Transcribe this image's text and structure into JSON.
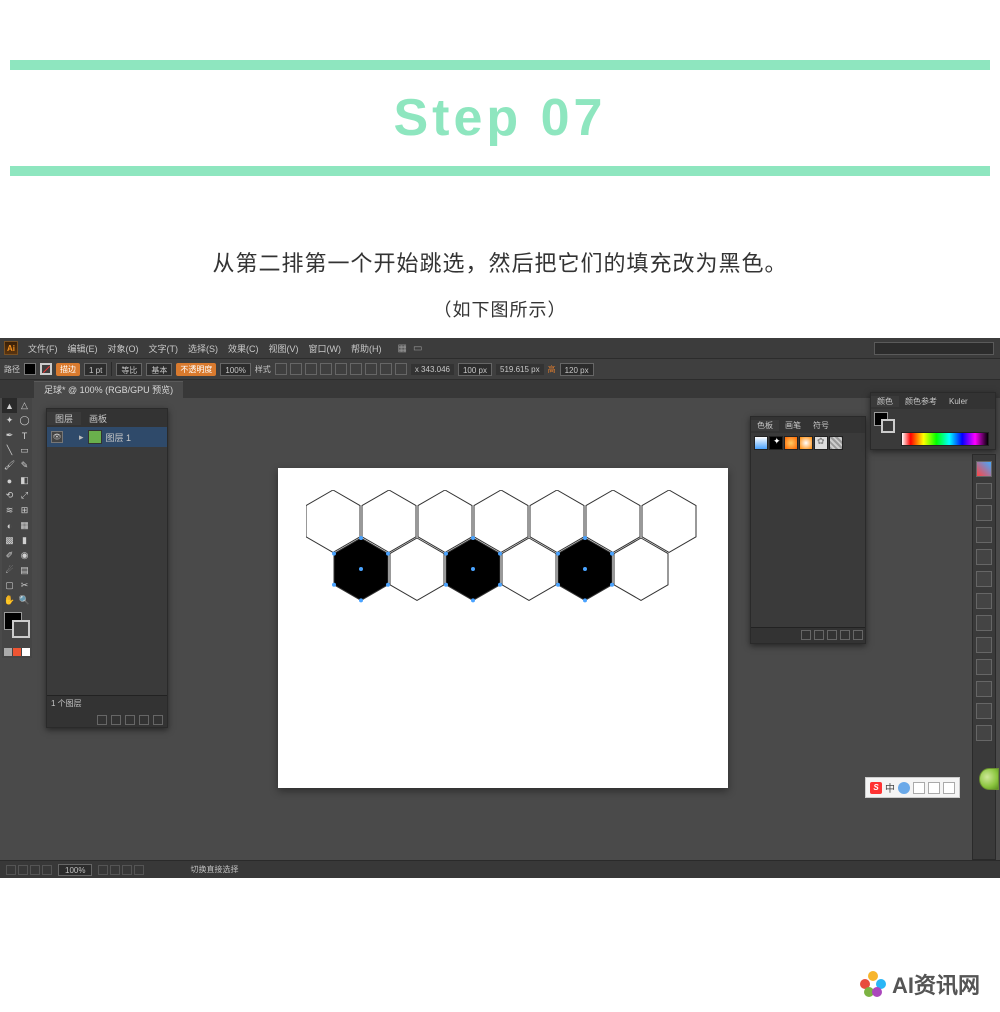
{
  "step": {
    "label": "Step 07"
  },
  "instruction": {
    "main": "从第二排第一个开始跳选，然后把它们的填充改为黑色。",
    "sub": "（如下图所示）"
  },
  "illustrator": {
    "menu": {
      "items": [
        "文件(F)",
        "编辑(E)",
        "对象(O)",
        "文字(T)",
        "选择(S)",
        "效果(C)",
        "视图(V)",
        "窗口(W)",
        "帮助(H)"
      ]
    },
    "control": {
      "pathLabel": "路径",
      "strokeBtn": "描边",
      "strokeWeight": "1 pt",
      "uniformLabel": "等比",
      "basicLabel": "基本",
      "opacityLabel": "不透明度",
      "opacity": "100%",
      "styleLabel": "样式",
      "x": "343.046",
      "yUnit": "px",
      "w": "100 px",
      "wh": "519.615",
      "hUnit": "px",
      "hLabel": "高",
      "h": "120 px"
    },
    "tab": "足球* @ 100% (RGB/GPU 预览)",
    "layersPanel": {
      "tabs": [
        "图层",
        "画板"
      ],
      "layerName": "图层 1",
      "footer": "1 个图层"
    },
    "swatchPanel": {
      "tabs": [
        "色板",
        "画笔",
        "符号"
      ]
    },
    "colorPanel": {
      "tabs": [
        "颜色",
        "颜色参考",
        "Kuler"
      ]
    },
    "status": {
      "zoom": "100%",
      "hint": "切换直接选择"
    },
    "ime": "中"
  },
  "watermark": "AI资讯网"
}
